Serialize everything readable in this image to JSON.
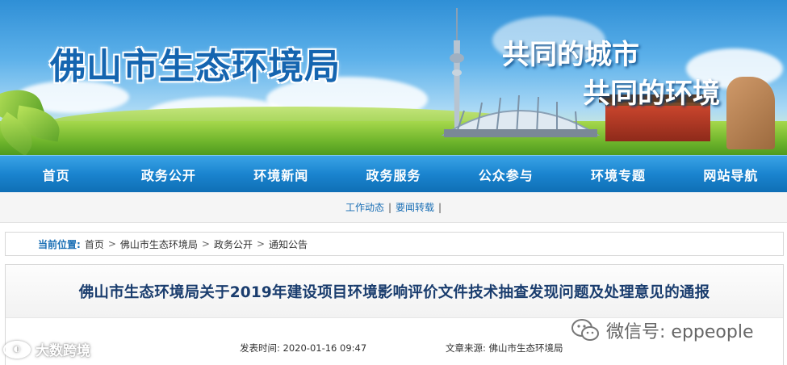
{
  "banner": {
    "site_title": "佛山市生态环境局",
    "slogan_line1": "共同的城市",
    "slogan_line2": "共同的环境"
  },
  "nav": {
    "items": [
      "首页",
      "政务公开",
      "环境新闻",
      "政务服务",
      "公众参与",
      "环境专题",
      "网站导航"
    ]
  },
  "subnav": {
    "links": [
      "工作动态",
      "要闻转载"
    ],
    "separator": "|"
  },
  "breadcrumb": {
    "label": "当前位置:",
    "items": [
      "首页",
      "佛山市生态环境局",
      "政务公开",
      "通知公告"
    ],
    "separator": ">"
  },
  "article": {
    "title": "佛山市生态环境局关于2019年建设项目环境影响评价文件技术抽查发现问题及处理意见的通报",
    "date_text": "发表时间: 2020-01-16 09:47",
    "source_text": "文章来源: 佛山市生态环境局"
  },
  "watermarks": {
    "left_text": "大数跨境",
    "right_text": "微信号: eppeople"
  }
}
